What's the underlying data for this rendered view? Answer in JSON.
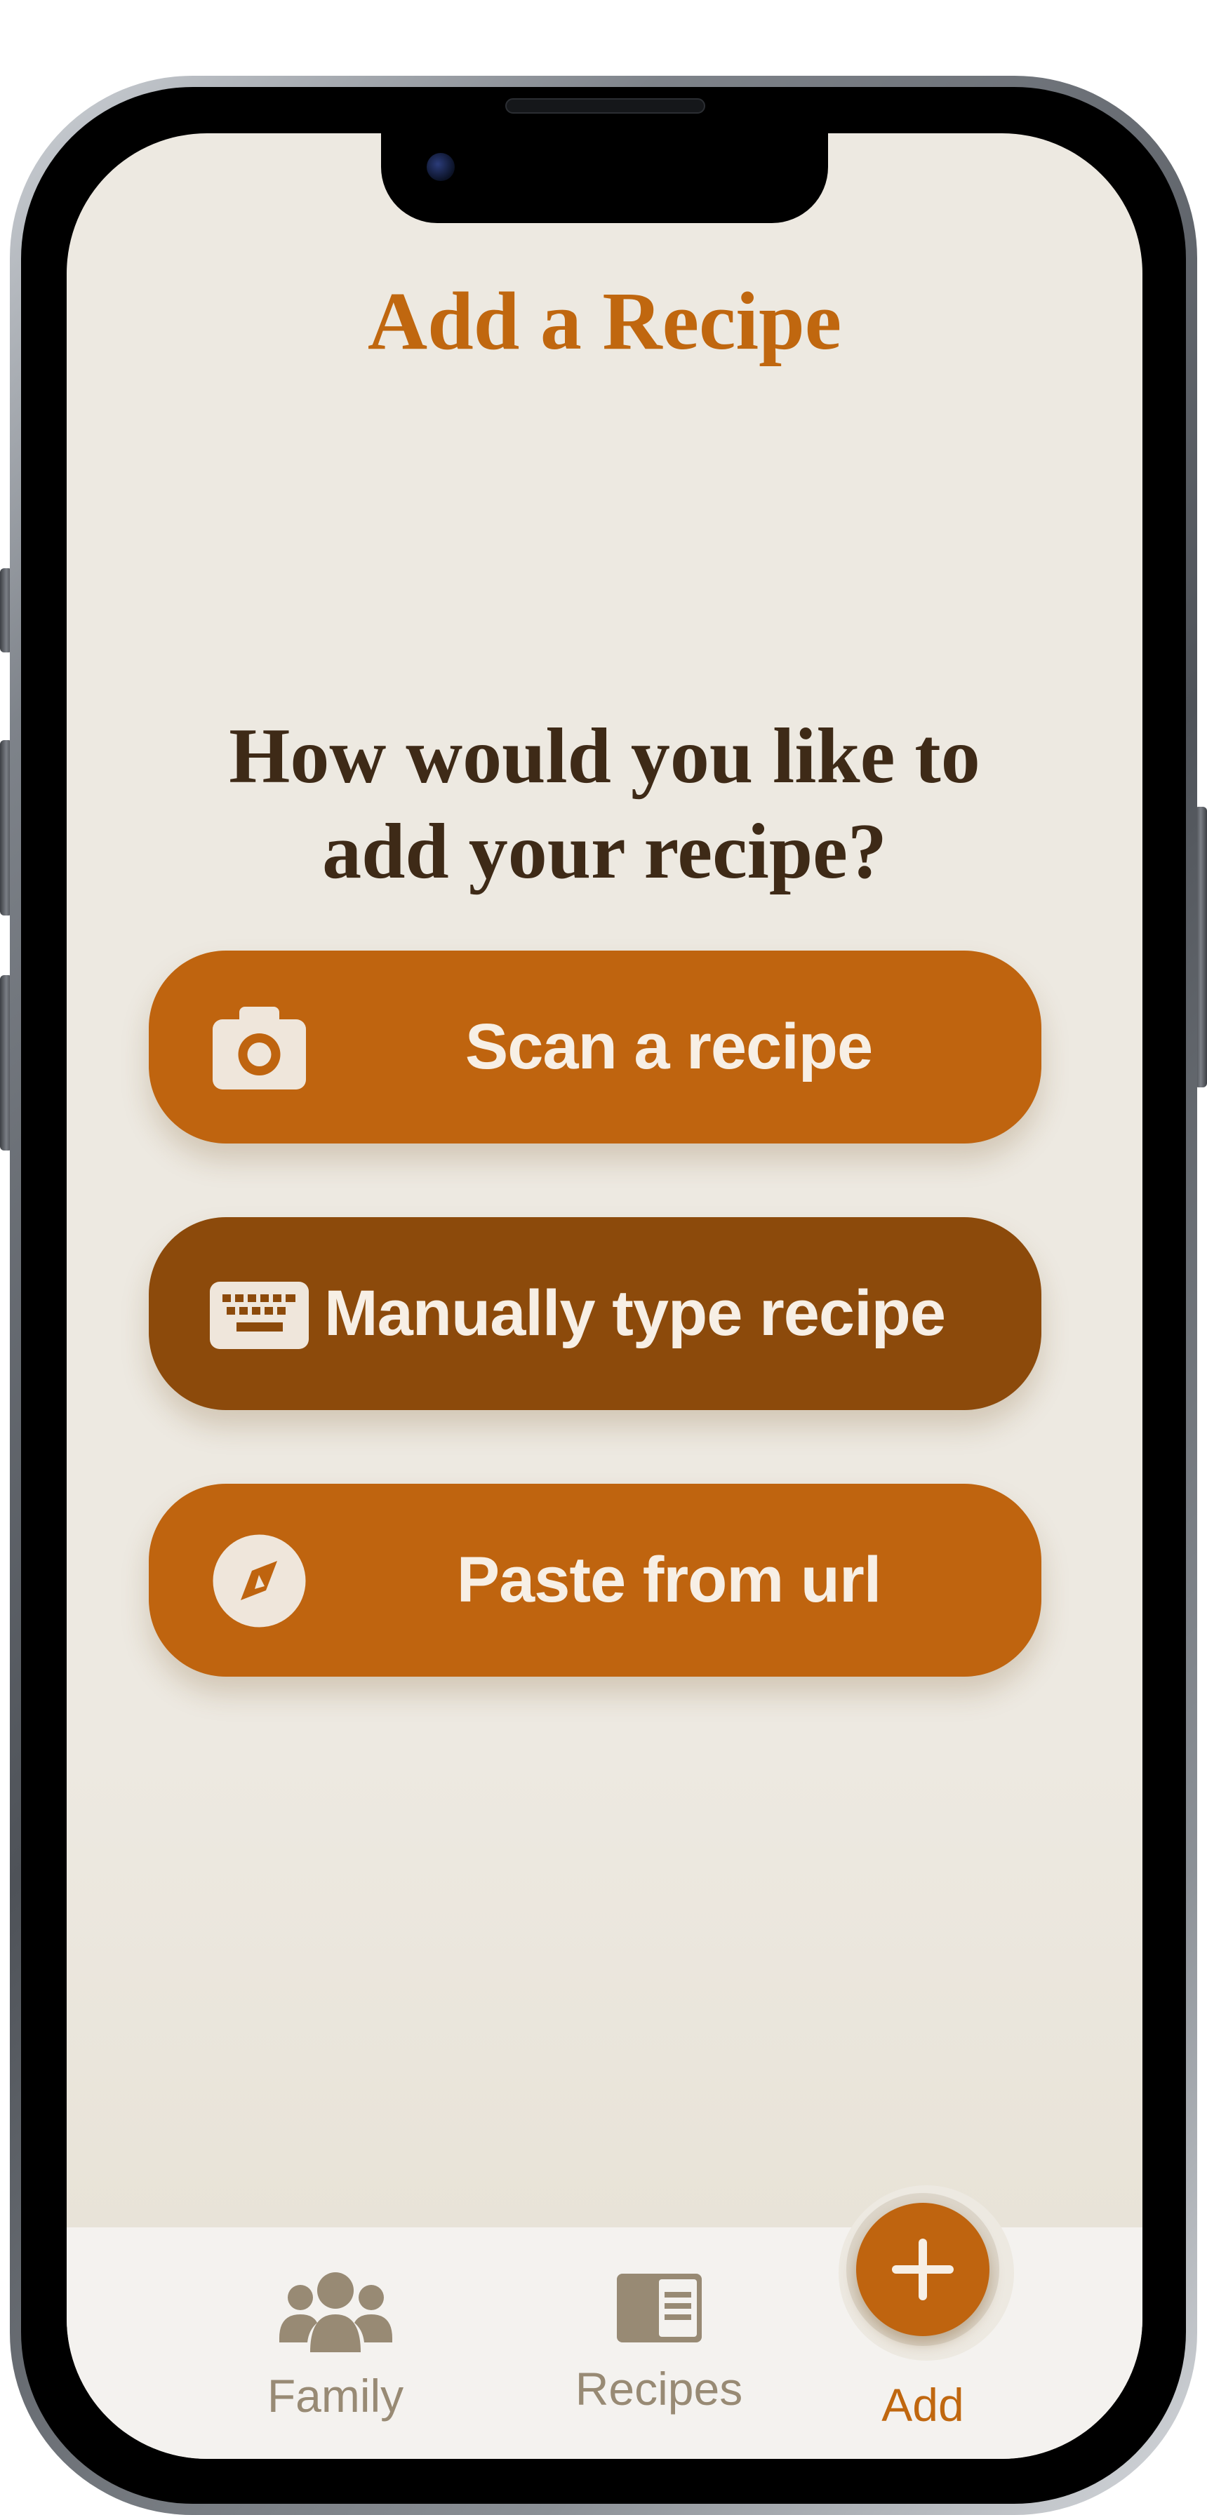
{
  "screen": {
    "title": "Add a Recipe",
    "question": "How would you like to add your recipe?"
  },
  "options": [
    {
      "label": "Scan a recipe",
      "icon": "camera-icon",
      "color": "#bf640f"
    },
    {
      "label": "Manually type recipe",
      "icon": "keyboard-icon",
      "color": "#8c4a0b"
    },
    {
      "label": "Paste from url",
      "icon": "compass-icon",
      "color": "#bf640f"
    }
  ],
  "tabbar": {
    "items": [
      {
        "label": "Family",
        "icon": "family-icon",
        "active": false
      },
      {
        "label": "Recipes",
        "icon": "recipe-book-icon",
        "active": false
      },
      {
        "label": "Add",
        "icon": "plus-icon",
        "active": true
      }
    ]
  },
  "colors": {
    "accent": "#bf640f",
    "accent_dark": "#8c4a0b",
    "title": "#c0670f",
    "text_dark": "#3e2a17",
    "background": "#ede9e1",
    "tab_inactive": "#988a74"
  }
}
